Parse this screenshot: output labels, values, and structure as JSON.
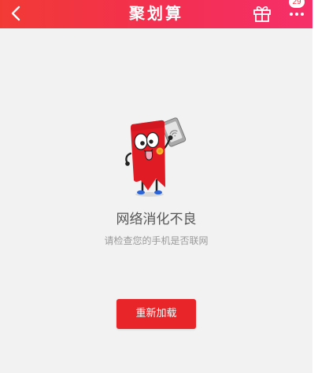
{
  "navbar": {
    "title": "聚划算",
    "back_icon": "chevron-left-icon",
    "gift_icon": "gift-icon",
    "more_icon": "more-icon",
    "badge_count": "29",
    "background": "#f2324a"
  },
  "empty_state": {
    "illustration": "tag-mascot-holding-phone-no-wifi",
    "title": "网络消化不良",
    "description": "请检查您的手机是否联网"
  },
  "reload_button": {
    "label": "重新加载",
    "color": "#e8262a"
  }
}
